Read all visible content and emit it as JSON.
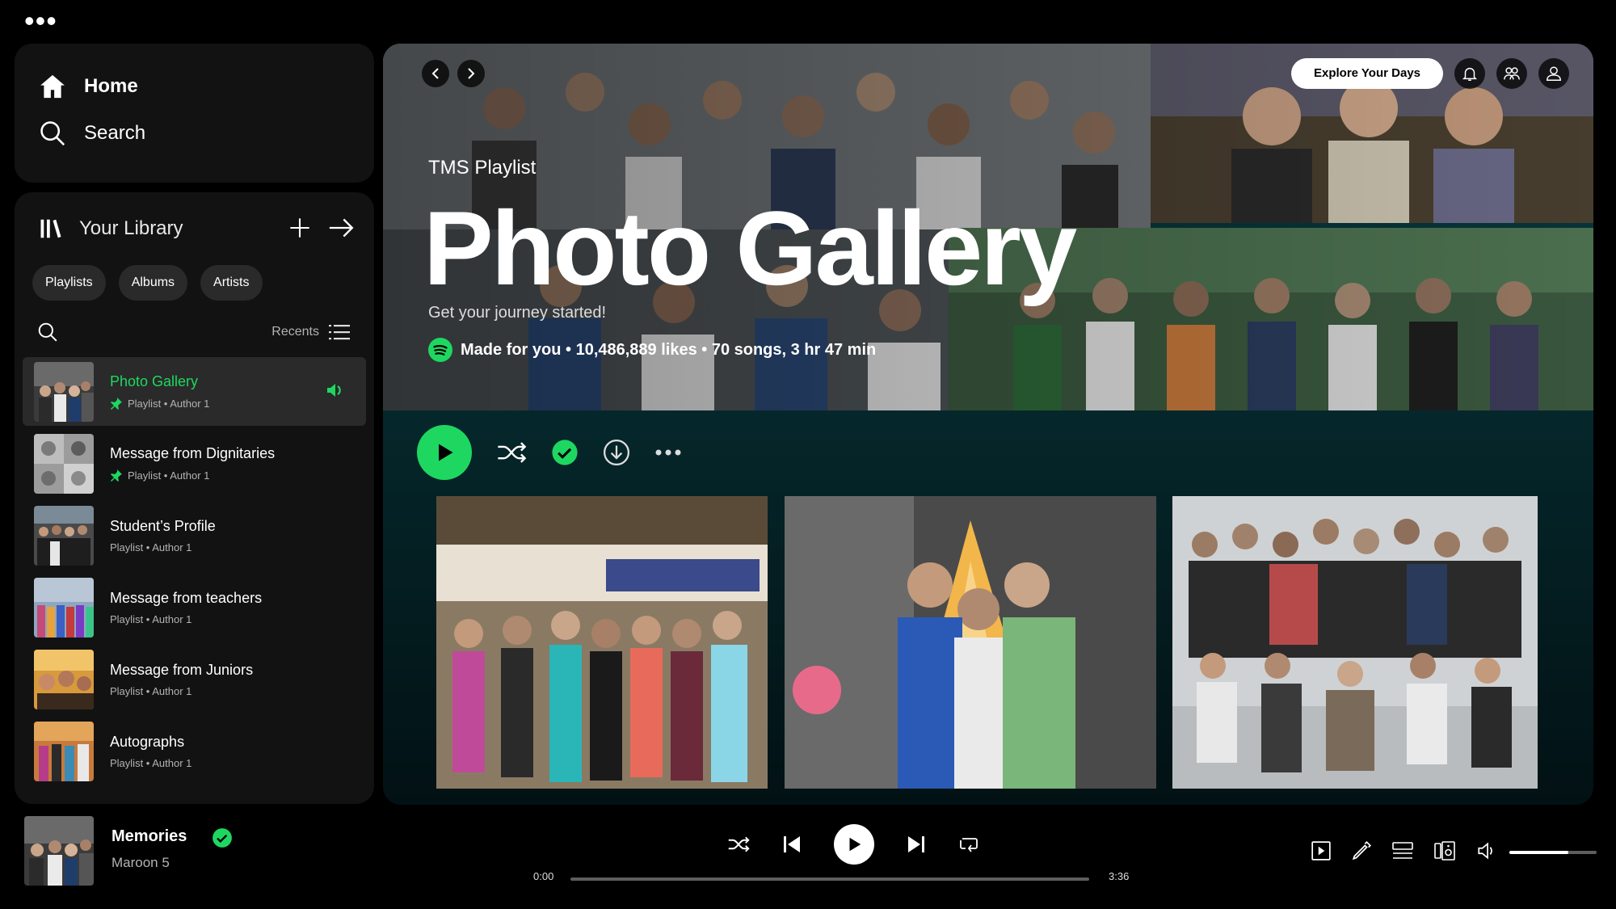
{
  "nav": {
    "home": "Home",
    "search": "Search"
  },
  "library": {
    "title": "Your Library",
    "chips": [
      "Playlists",
      "Albums",
      "Artists"
    ],
    "recents": "Recents",
    "items": [
      {
        "title": "Photo Gallery",
        "sub": "Playlist • Author 1",
        "pinned": true,
        "active": true
      },
      {
        "title": "Message from Dignitaries",
        "sub": "Playlist • Author 1",
        "pinned": true
      },
      {
        "title": "Student’s Profile",
        "sub": "Playlist • Author 1"
      },
      {
        "title": "Message from teachers",
        "sub": "Playlist • Author 1"
      },
      {
        "title": "Message from Juniors",
        "sub": "Playlist • Author 1"
      },
      {
        "title": "Autographs",
        "sub": "Playlist • Author 1"
      }
    ]
  },
  "header": {
    "explore_label": "Explore Your Days"
  },
  "playlist": {
    "type": "TMS Playlist",
    "title": "Photo Gallery",
    "description": "Get your journey started!",
    "meta": "Made for you • 10,486,889 likes • 70 songs, 3 hr 47 min"
  },
  "now_playing": {
    "title": "Memories",
    "artist": "Maroon 5",
    "elapsed": "0:00",
    "duration": "3:36",
    "progress": 0.0,
    "volume": 0.68
  },
  "colors": {
    "accent": "#1ed760",
    "panel": "#121212",
    "main_gradient_top": "#0a4a4f"
  }
}
